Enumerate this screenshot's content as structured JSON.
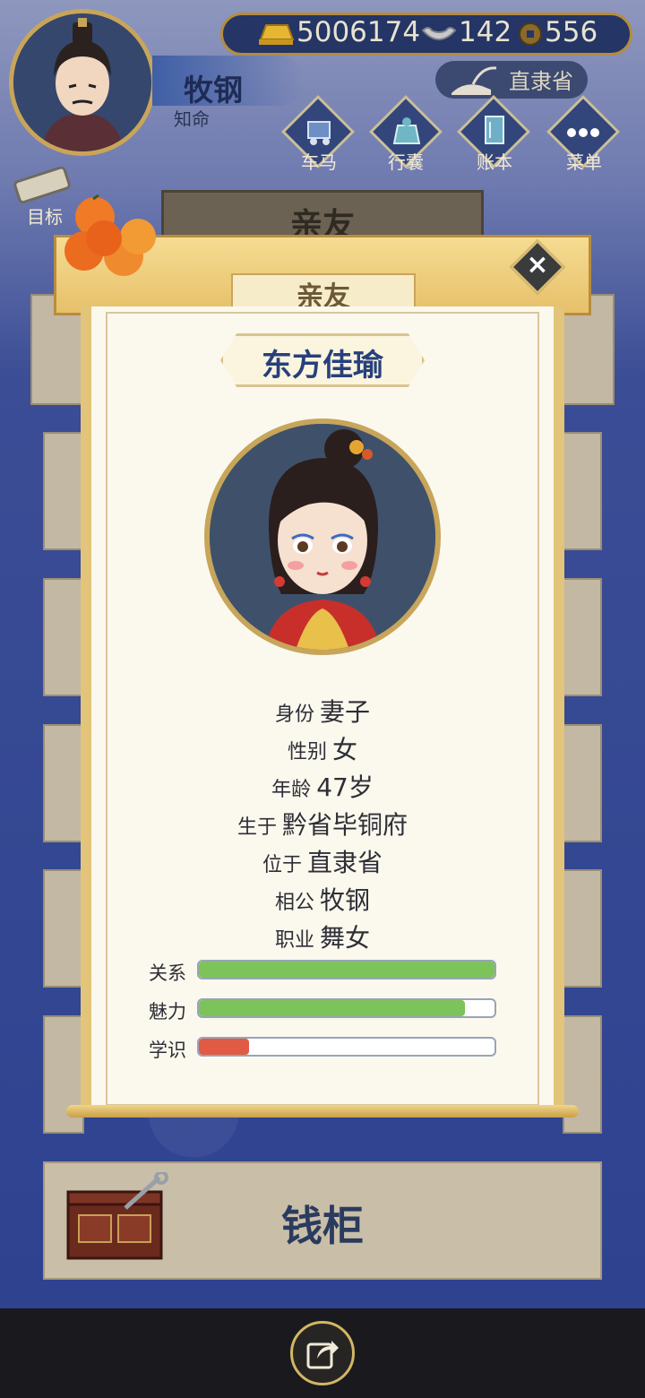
{
  "player": {
    "name": "牧钢",
    "rank": "知命",
    "location": "直隶省"
  },
  "currency": {
    "gold": "5006174",
    "silver": "142",
    "coins": "556"
  },
  "menu": {
    "items": [
      {
        "label": "车马",
        "icon": "carriage-icon"
      },
      {
        "label": "行囊",
        "icon": "bag-icon"
      },
      {
        "label": "账本",
        "icon": "ledger-icon"
      },
      {
        "label": "菜单",
        "icon": "more-dots-icon"
      }
    ],
    "goal": "目标"
  },
  "page": {
    "title": "亲友"
  },
  "dialog": {
    "title": "亲友",
    "character_name": "东方佳瑜",
    "info": [
      {
        "label": "身份",
        "value": "妻子"
      },
      {
        "label": "性别",
        "value": "女"
      },
      {
        "label": "年龄",
        "value": "47岁"
      },
      {
        "label": "生于",
        "value": "黔省毕铜府"
      },
      {
        "label": "位于",
        "value": "直隶省"
      },
      {
        "label": "相公",
        "value": "牧钢"
      },
      {
        "label": "职业",
        "value": "舞女"
      }
    ],
    "stats": [
      {
        "label": "关系",
        "value": 1.0,
        "color": "#7cc45a"
      },
      {
        "label": "魅力",
        "value": 0.9,
        "color": "#7cc45a"
      },
      {
        "label": "学识",
        "value": 0.17,
        "color": "#e05a44"
      }
    ]
  },
  "chest": {
    "label": "钱柜"
  }
}
